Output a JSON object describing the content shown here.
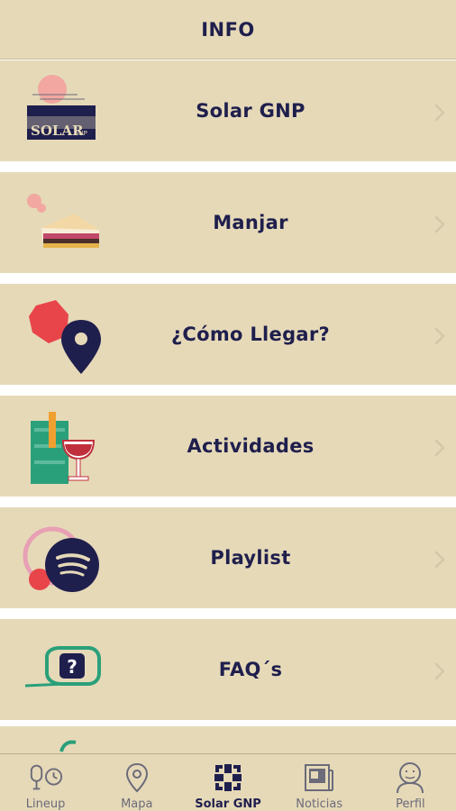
{
  "header": {
    "title": "INFO"
  },
  "menu": {
    "items": [
      {
        "label": "Solar GNP",
        "icon": "solar-gnp-poster-icon"
      },
      {
        "label": "Manjar",
        "icon": "sandwich-icon"
      },
      {
        "label": "¿Cómo Llegar?",
        "icon": "map-pin-icon"
      },
      {
        "label": "Actividades",
        "icon": "wine-glass-icon"
      },
      {
        "label": "Playlist",
        "icon": "spotify-icon"
      },
      {
        "label": "FAQ´s",
        "icon": "question-bubble-icon"
      }
    ]
  },
  "tabbar": {
    "tabs": [
      {
        "label": "Lineup",
        "icon": "microphone-clock-icon",
        "active": false
      },
      {
        "label": "Mapa",
        "icon": "map-pin-outline-icon",
        "active": false
      },
      {
        "label": "Solar GNP",
        "icon": "solar-logo-icon",
        "active": true
      },
      {
        "label": "Noticias",
        "icon": "newspaper-icon",
        "active": false
      },
      {
        "label": "Perfil",
        "icon": "user-face-icon",
        "active": false
      }
    ]
  },
  "colors": {
    "background": "#e6d9b8",
    "navy": "#1f1f4d",
    "coral": "#e8454a",
    "green": "#2aa07a",
    "separator": "#ffffff"
  }
}
